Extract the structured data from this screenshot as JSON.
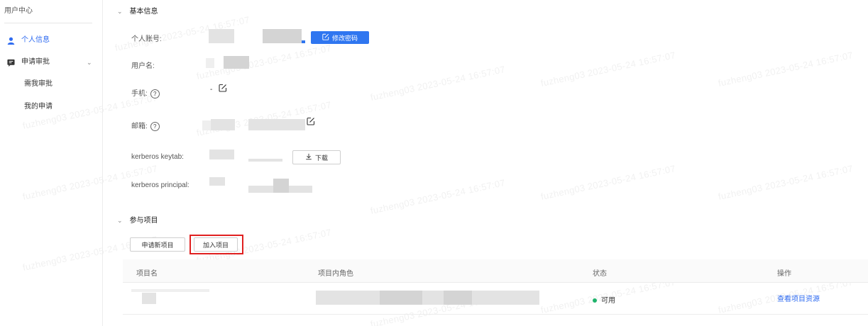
{
  "sidebar": {
    "title": "用户中心",
    "items": [
      {
        "label": "个人信息",
        "icon": "user-icon"
      },
      {
        "label": "申请审批",
        "icon": "message-icon"
      },
      {
        "label": "需我审批"
      },
      {
        "label": "我的申请"
      }
    ]
  },
  "basic_info": {
    "section_title": "基本信息",
    "account_label": "个人账号:",
    "change_password_label": "修改密码",
    "username_label": "用户名:",
    "phone_label": "手机:",
    "phone_value": "-",
    "email_label": "邮箱:",
    "keytab_label": "kerberos keytab:",
    "download_label": "下载",
    "principal_label": "kerberos principal:"
  },
  "projects": {
    "section_title": "参与项目",
    "apply_new_label": "申请新项目",
    "join_label": "加入项目",
    "columns": [
      "项目名",
      "项目内角色",
      "状态",
      "操作"
    ],
    "rows": [
      {
        "status": "可用",
        "action": "查看项目资源"
      }
    ]
  },
  "watermark": "fuzheng03 2023-05-24 16:57:07",
  "colors": {
    "accent": "#2f76f0",
    "status_ok": "#1fb36b",
    "highlight": "#e02020"
  }
}
